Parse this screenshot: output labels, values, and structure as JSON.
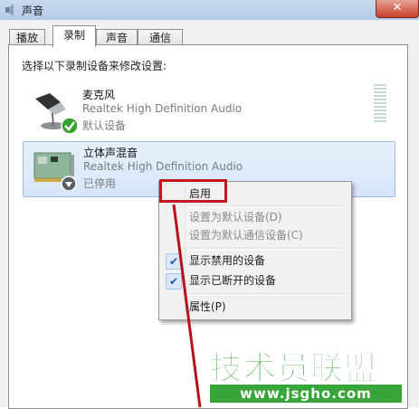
{
  "window": {
    "title": "声音",
    "close_label": "✕",
    "icon": "speaker-icon"
  },
  "tabs": [
    {
      "label": "播放",
      "active": false
    },
    {
      "label": "录制",
      "active": true
    },
    {
      "label": "声音",
      "active": false
    },
    {
      "label": "通信",
      "active": false
    }
  ],
  "instruction": "选择以下录制设备来修改设置:",
  "devices": [
    {
      "name": "麦克风",
      "driver": "Realtek High Definition Audio",
      "status": "默认设备",
      "icon": "microphone-icon",
      "badge": "default-check-icon",
      "selected": false
    },
    {
      "name": "立体声混音",
      "driver": "Realtek High Definition Audio",
      "status": "已停用",
      "icon": "sound-card-icon",
      "badge": "disabled-arrow-icon",
      "selected": true
    }
  ],
  "context_menu": {
    "items": [
      {
        "label": "启用",
        "enabled": true,
        "checked": false
      },
      {
        "label": "设置为默认设备(D)",
        "enabled": false,
        "checked": false
      },
      {
        "label": "设置为默认通信设备(C)",
        "enabled": false,
        "checked": false
      },
      {
        "label": "显示禁用的设备",
        "enabled": true,
        "checked": true
      },
      {
        "label": "显示已断开的设备",
        "enabled": true,
        "checked": true
      },
      {
        "label": "属性(P)",
        "enabled": true,
        "checked": false
      }
    ]
  },
  "watermark": {
    "title": "技术员联盟",
    "url": "www.jsgho.com"
  },
  "colors": {
    "highlight_box": "#c4161c",
    "watermark_green": "#38a53b",
    "selection": "#d6e6f8"
  }
}
